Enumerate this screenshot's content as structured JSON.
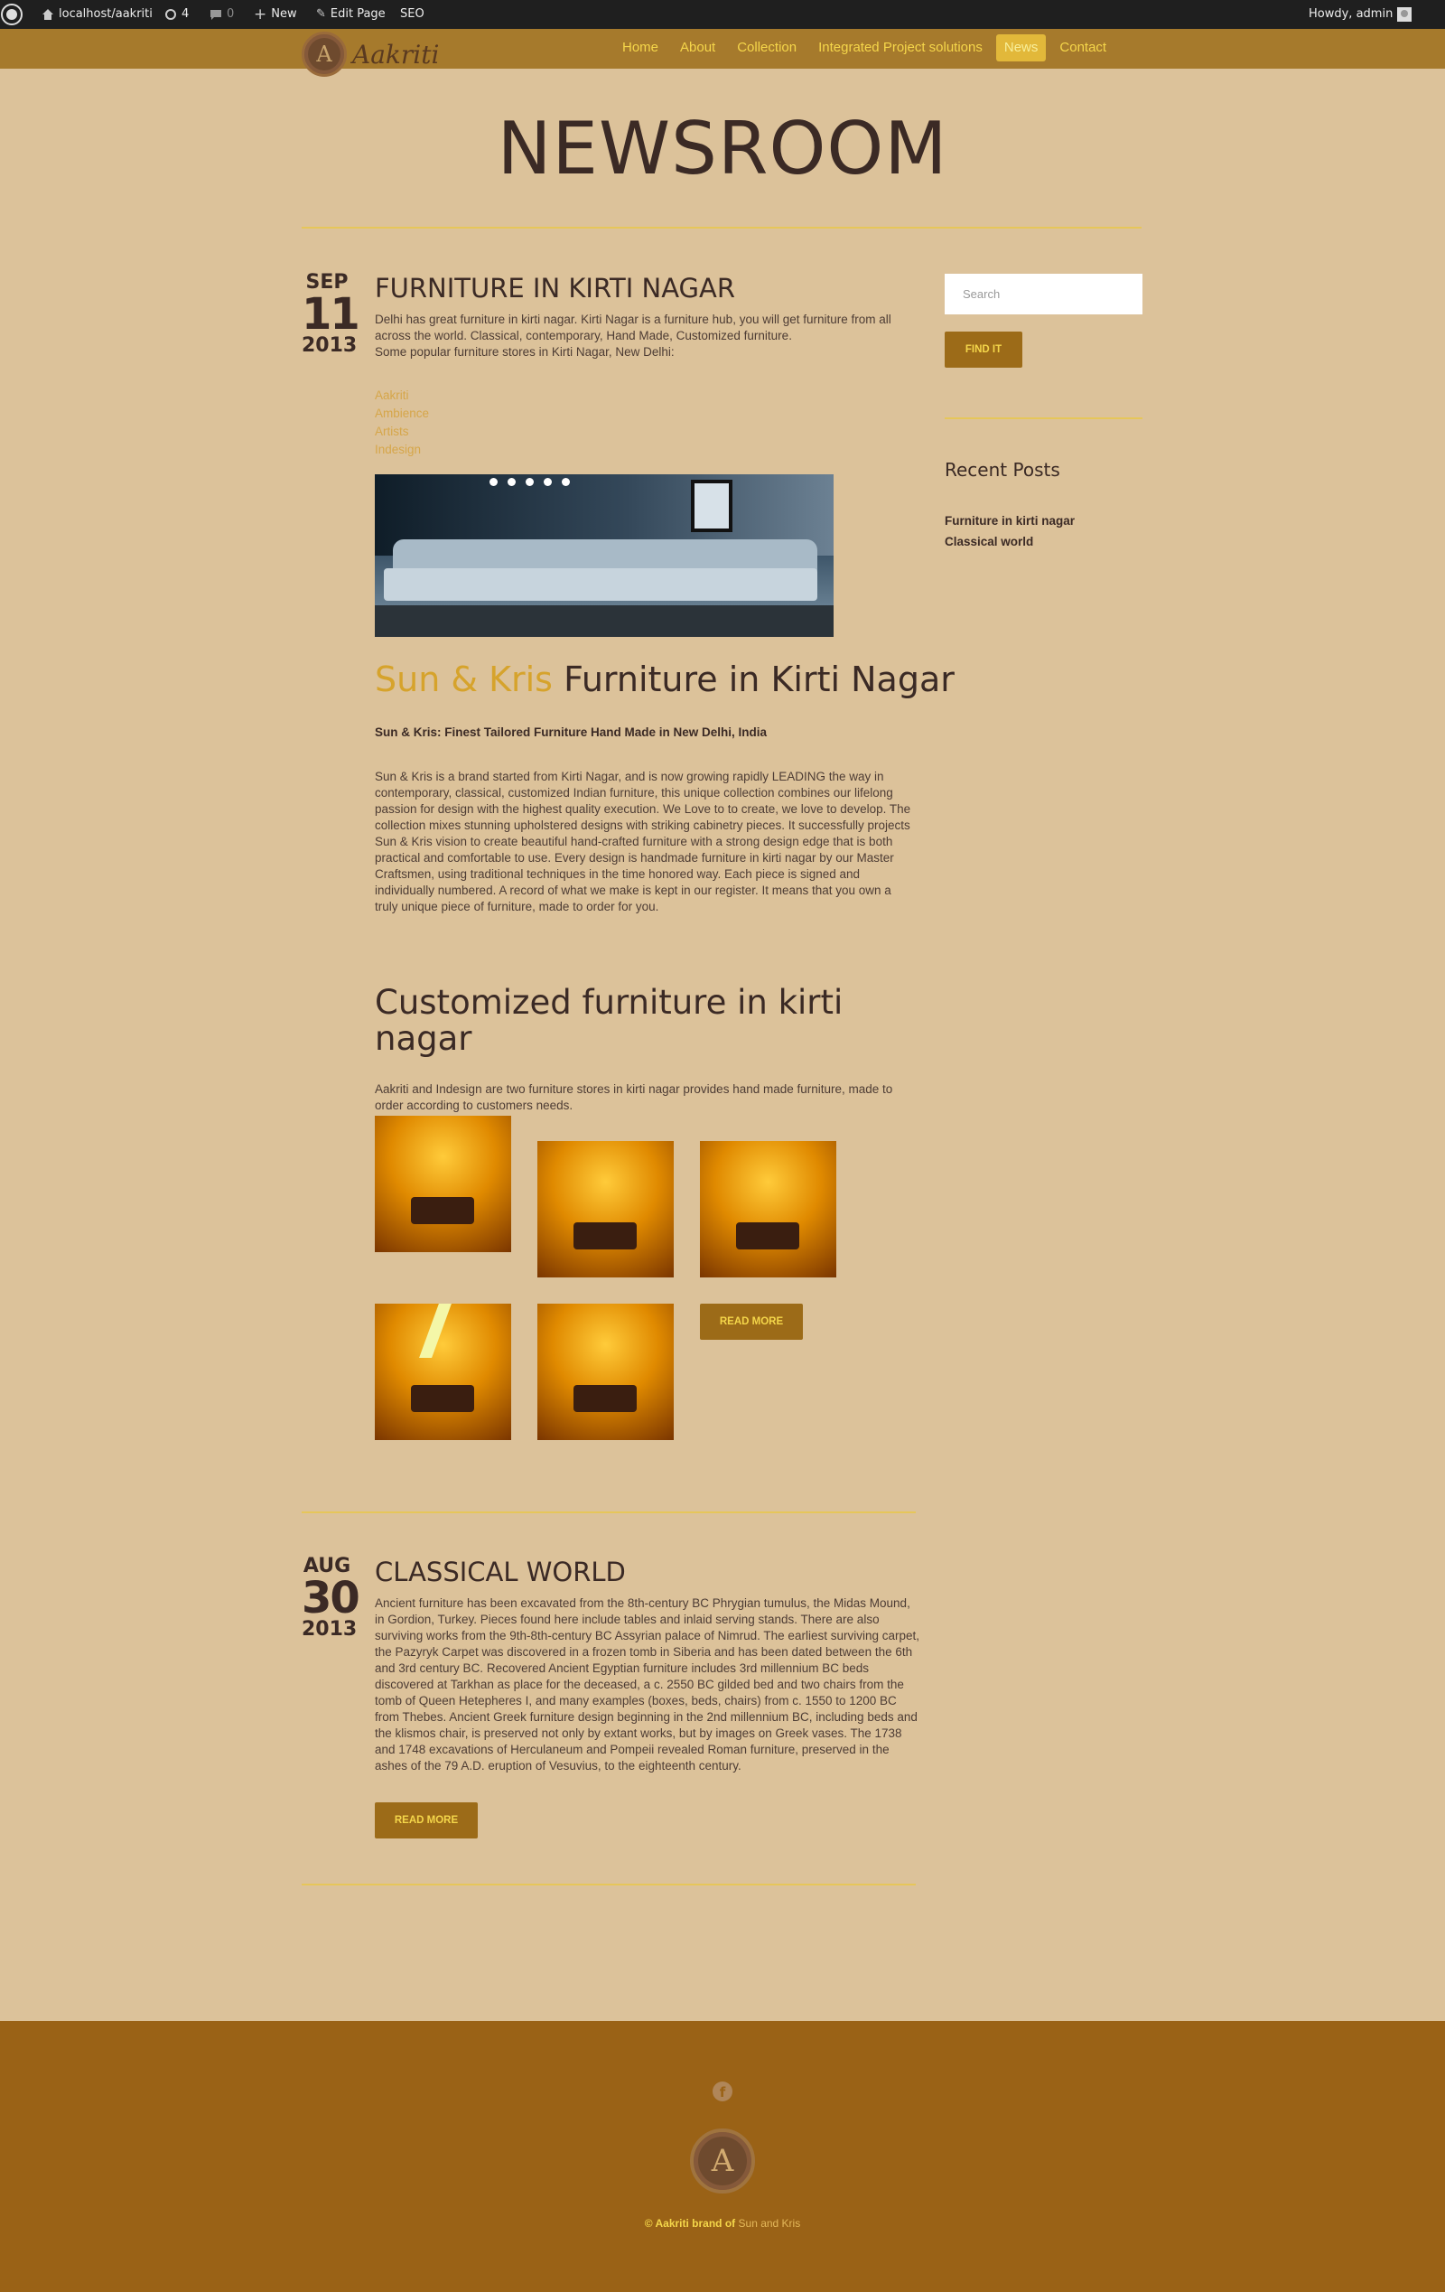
{
  "adminbar": {
    "site": "localhost/aakriti",
    "updates": "4",
    "comments": "0",
    "new": "New",
    "edit_page": "Edit Page",
    "seo": "SEO",
    "howdy": "Howdy, admin"
  },
  "header": {
    "logo_letter": "A",
    "logo_text": "Aakriti",
    "nav": [
      "Home",
      "About",
      "Collection",
      "Integrated Project solutions",
      "News",
      "Contact"
    ],
    "active_nav": "News"
  },
  "page": {
    "title": "NEWSROOM"
  },
  "posts": [
    {
      "month": "SEP",
      "day": "11",
      "year": "2013",
      "title": "FURNITURE IN KIRTI NAGAR",
      "intro": "Delhi has great furniture in kirti nagar. Kirti Nagar is a furniture hub, you will get furniture from all across the world. Classical, contemporary, Hand Made, Customized furniture.",
      "intro2": "Some popular furniture stores in Kirti Nagar, New Delhi:",
      "stores": [
        "Aakriti",
        "Ambience",
        "Artists",
        "Indesign"
      ],
      "heading_accent": "Sun & Kris",
      "heading_rest": " Furniture in Kirti Nagar",
      "bold_line": "Sun & Kris: Finest Tailored Furniture Hand Made in New Delhi, India",
      "body": "Sun & Kris is a brand started from Kirti Nagar, and is now growing rapidly LEADING the way in contemporary, classical, customized Indian furniture, this unique collection combines our lifelong passion for design with the highest quality execution. We Love to to create, we love to develop. The collection mixes stunning upholstered designs with striking cabinetry pieces. It successfully projects Sun & Kris vision to create beautiful hand-crafted furniture with a strong design edge that is both practical and comfortable to use. Every design is handmade furniture in kirti nagar  by our Master Craftsmen, using traditional techniques in the time honored way. Each piece is signed and individually numbered. A record of what we make is kept in our register. It means that you own a truly unique piece of furniture, made to order for you.",
      "h2": "Customized furniture in kirti nagar",
      "body2": "Aakriti and Indesign are two furniture stores in kirti nagar provides hand made furniture, made to order according to customers needs.",
      "read_more": "READ MORE"
    },
    {
      "month": "AUG",
      "day": "30",
      "year": "2013",
      "title": "CLASSICAL WORLD",
      "body": "Ancient furniture has been excavated from the 8th-century BC Phrygian tumulus, the Midas Mound, in Gordion, Turkey. Pieces found here include tables and inlaid serving stands. There are also surviving works from the 9th-8th-century BC Assyrian palace of Nimrud. The earliest surviving carpet, the Pazyryk Carpet was discovered in a frozen tomb in Siberia and has been dated between the 6th and 3rd century BC. Recovered Ancient Egyptian furniture includes 3rd millennium BC beds discovered at Tarkhan as place for the deceased, a c. 2550 BC gilded bed and two chairs from the tomb of Queen Hetepheres I, and many examples (boxes, beds, chairs) from c. 1550 to 1200 BC from Thebes. Ancient Greek furniture design beginning in the 2nd millennium BC, including beds and the klismos chair, is preserved not only by extant works, but by images on Greek vases. The 1738 and 1748 excavations of Herculaneum and Pompeii revealed Roman furniture, preserved in the ashes of the 79 A.D. eruption of Vesuvius, to the eighteenth century.",
      "read_more": "READ MORE"
    }
  ],
  "sidebar": {
    "search_placeholder": "Search",
    "find_button": "FIND IT",
    "recent_title": "Recent Posts",
    "recent_posts": [
      "Furniture in kirti nagar",
      "Classical world"
    ]
  },
  "footer": {
    "facebook_icon": "facebook-icon",
    "logo_letter": "A",
    "copyright_prefix": "© Aakriti brand of ",
    "copyright_link": "Sun and Kris"
  },
  "colors": {
    "background": "#dcc29a",
    "header": "#a67a2c",
    "nav_text": "#f5d64a",
    "accent": "#d6a32c",
    "button": "#9c6b18",
    "footer": "#9a6216"
  }
}
